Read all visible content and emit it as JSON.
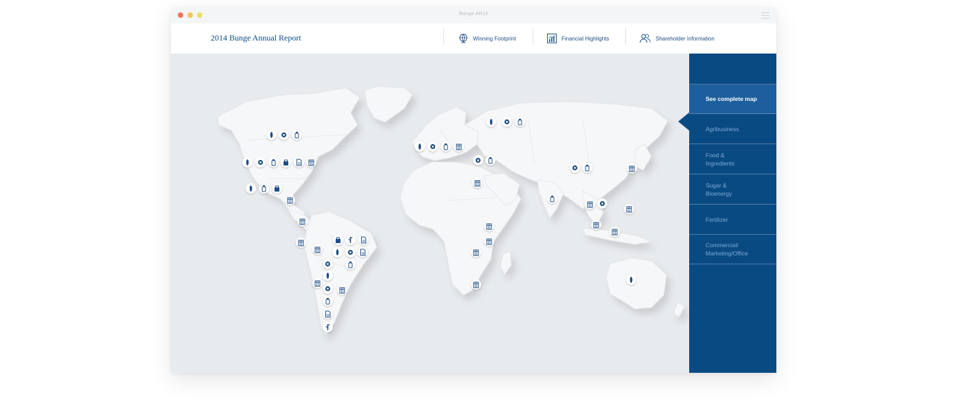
{
  "window": {
    "title": "Bunge AR14"
  },
  "header": {
    "title": "2014 Bunge Annual Report",
    "nav": [
      {
        "label": "Winning Footprint",
        "icon": "globe-icon"
      },
      {
        "label": "Financial Highlights",
        "icon": "bar-chart-icon"
      },
      {
        "label": "Shareholder Information",
        "icon": "people-icon"
      }
    ]
  },
  "sidebar": {
    "items": [
      {
        "label": "See complete map",
        "active": true
      },
      {
        "label": "Agribusiness",
        "active": false
      },
      {
        "label": "Food &\nIngredients",
        "active": false
      },
      {
        "label": "Sugar &\nBioenergy",
        "active": false
      },
      {
        "label": "Fertilizer",
        "active": false
      },
      {
        "label": "Commercial/\nMarketing/Office",
        "active": false
      }
    ]
  },
  "map": {
    "marker_types": [
      "wheat-icon",
      "gear-icon",
      "bottle-icon",
      "factory-icon",
      "office-icon",
      "fertilizer-bag-icon",
      "sugarcane-icon",
      "document-icon"
    ],
    "colors": {
      "accent": "#0a4a83",
      "land": "#f6f7f8",
      "water": "#e8ebee"
    }
  }
}
